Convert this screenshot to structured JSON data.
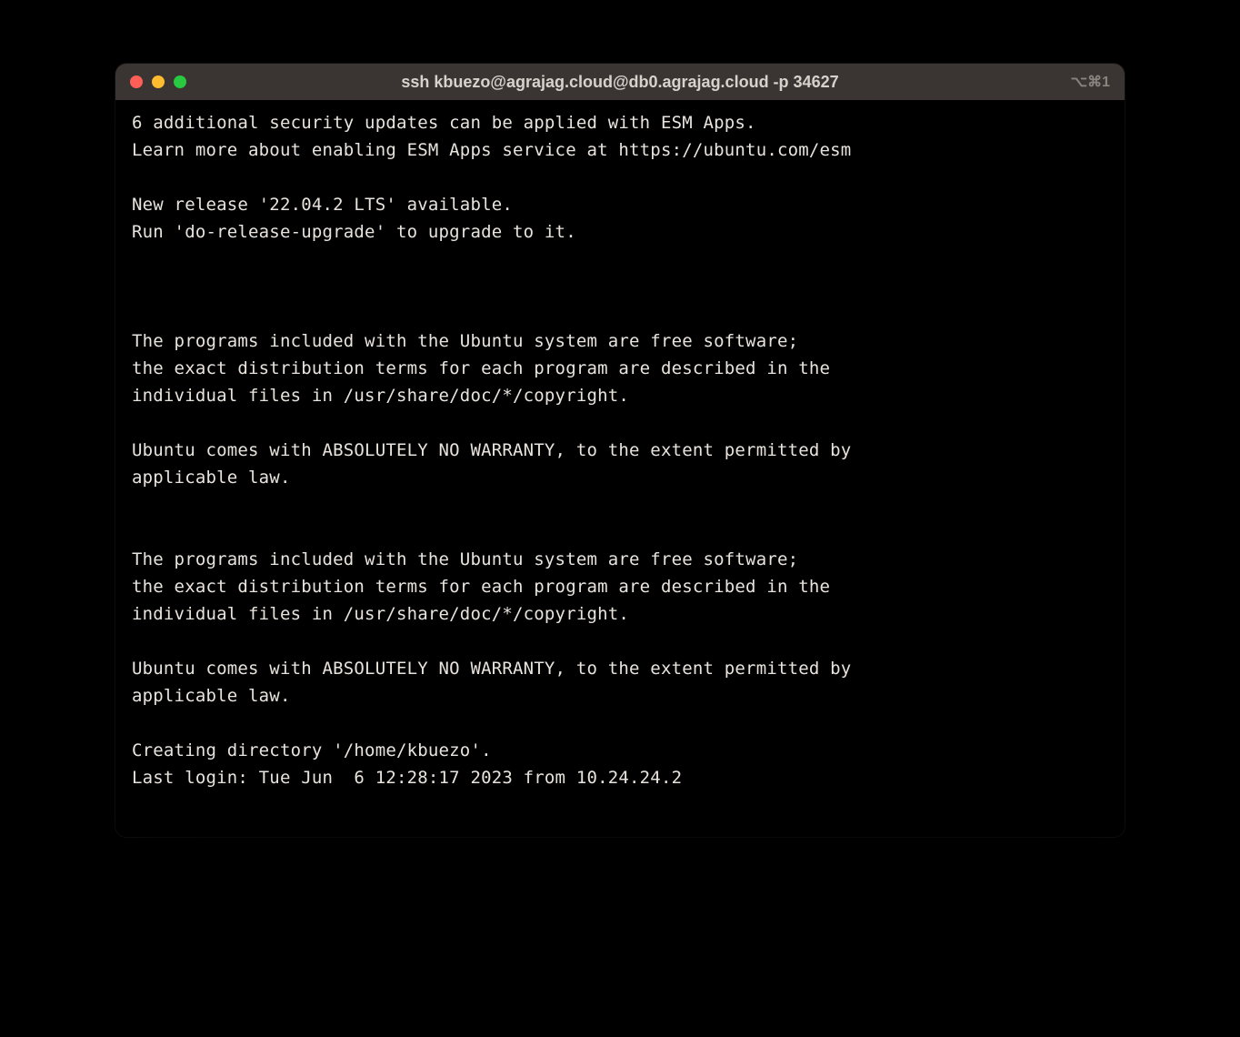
{
  "window": {
    "title": "ssh kbuezo@agrajag.cloud@db0.agrajag.cloud -p 34627",
    "shortcut_hint": "⌥⌘1"
  },
  "terminal": {
    "lines": [
      "6 additional security updates can be applied with ESM Apps.",
      "Learn more about enabling ESM Apps service at https://ubuntu.com/esm",
      "",
      "New release '22.04.2 LTS' available.",
      "Run 'do-release-upgrade' to upgrade to it.",
      "",
      "",
      "",
      "The programs included with the Ubuntu system are free software;",
      "the exact distribution terms for each program are described in the",
      "individual files in /usr/share/doc/*/copyright.",
      "",
      "Ubuntu comes with ABSOLUTELY NO WARRANTY, to the extent permitted by",
      "applicable law.",
      "",
      "",
      "The programs included with the Ubuntu system are free software;",
      "the exact distribution terms for each program are described in the",
      "individual files in /usr/share/doc/*/copyright.",
      "",
      "Ubuntu comes with ABSOLUTELY NO WARRANTY, to the extent permitted by",
      "applicable law.",
      "",
      "Creating directory '/home/kbuezo'.",
      "Last login: Tue Jun  6 12:28:17 2023 from 10.24.24.2"
    ]
  }
}
